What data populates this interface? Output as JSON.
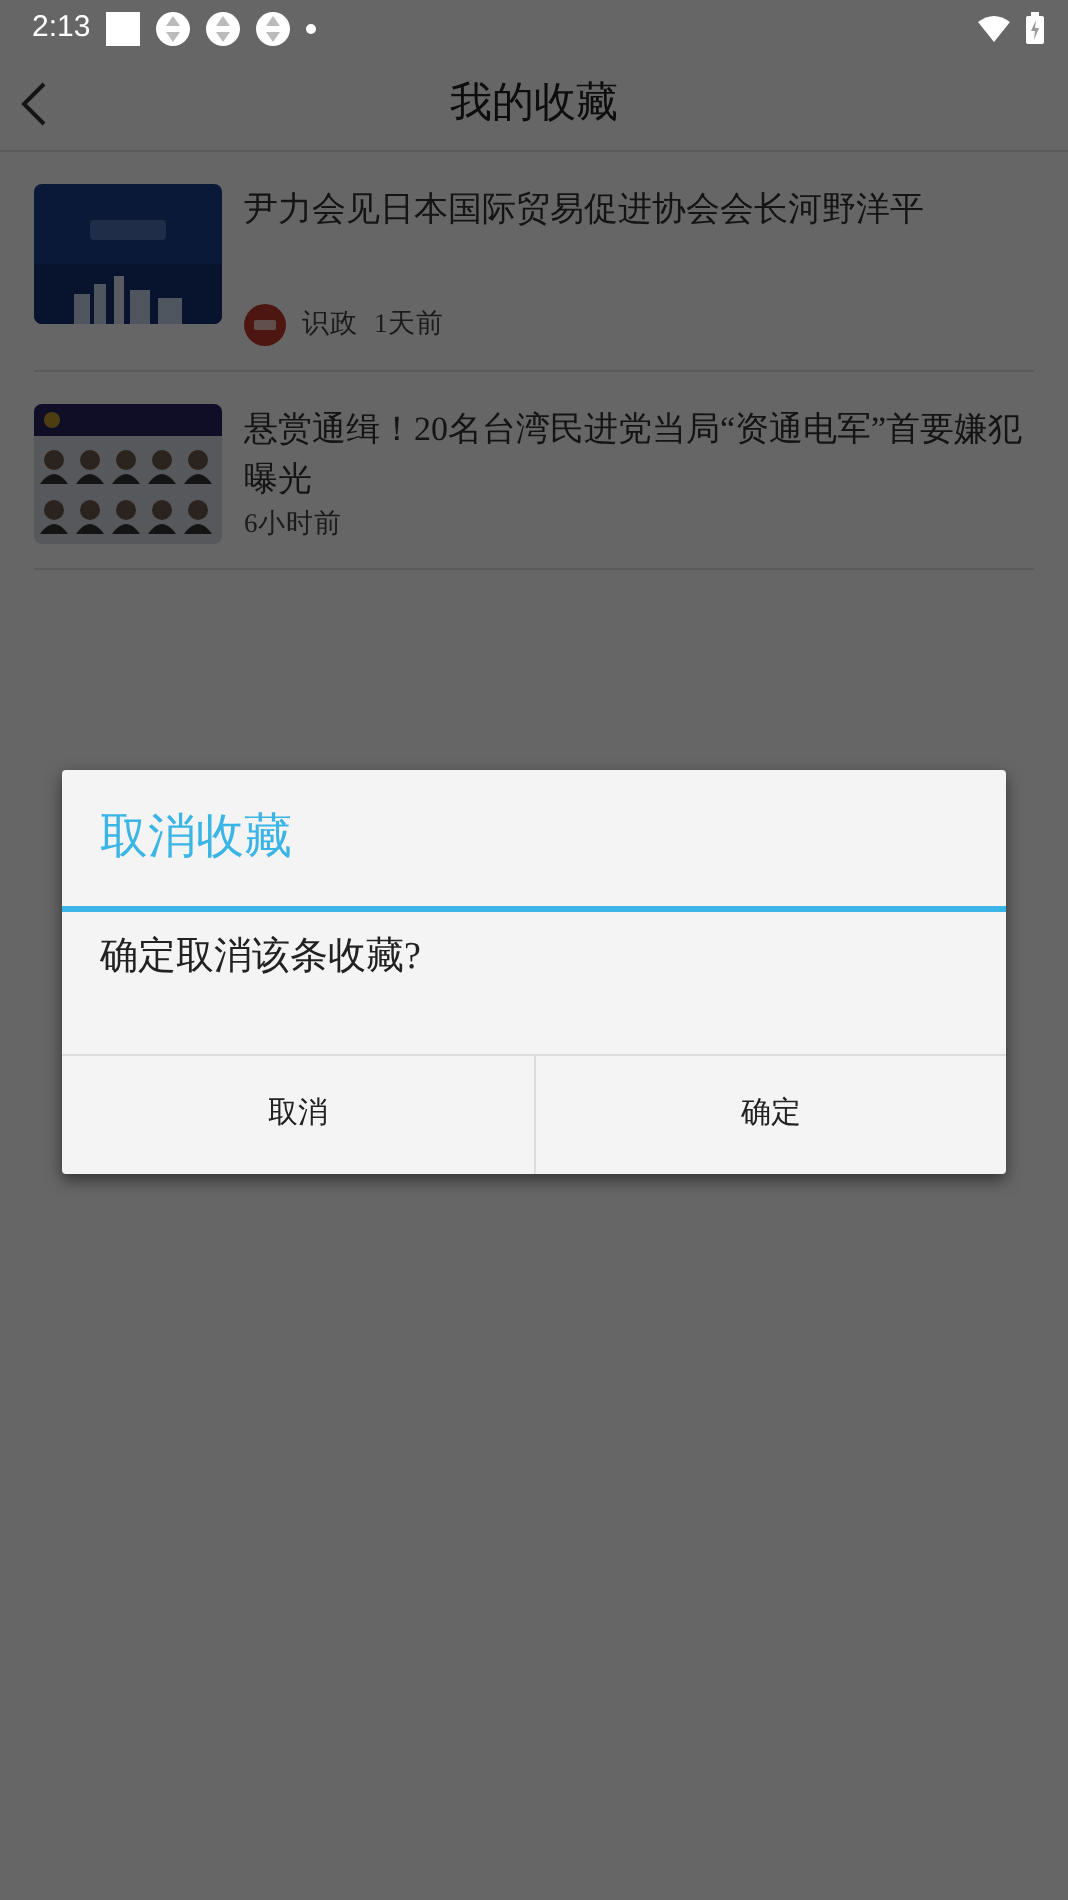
{
  "status_bar": {
    "time": "2:13"
  },
  "header": {
    "title": "我的收藏"
  },
  "articles": [
    {
      "title": "尹力会见日本国际贸易促进协会会长河野洋平",
      "source": "识政",
      "time": "1天前"
    },
    {
      "title": "悬赏通缉！20名台湾民进党当局“资通电军”首要嫌犯曝光",
      "time": "6小时前"
    }
  ],
  "dialog": {
    "title": "取消收藏",
    "message": "确定取消该条收藏?",
    "buttons": [
      "取消",
      "确定"
    ]
  }
}
